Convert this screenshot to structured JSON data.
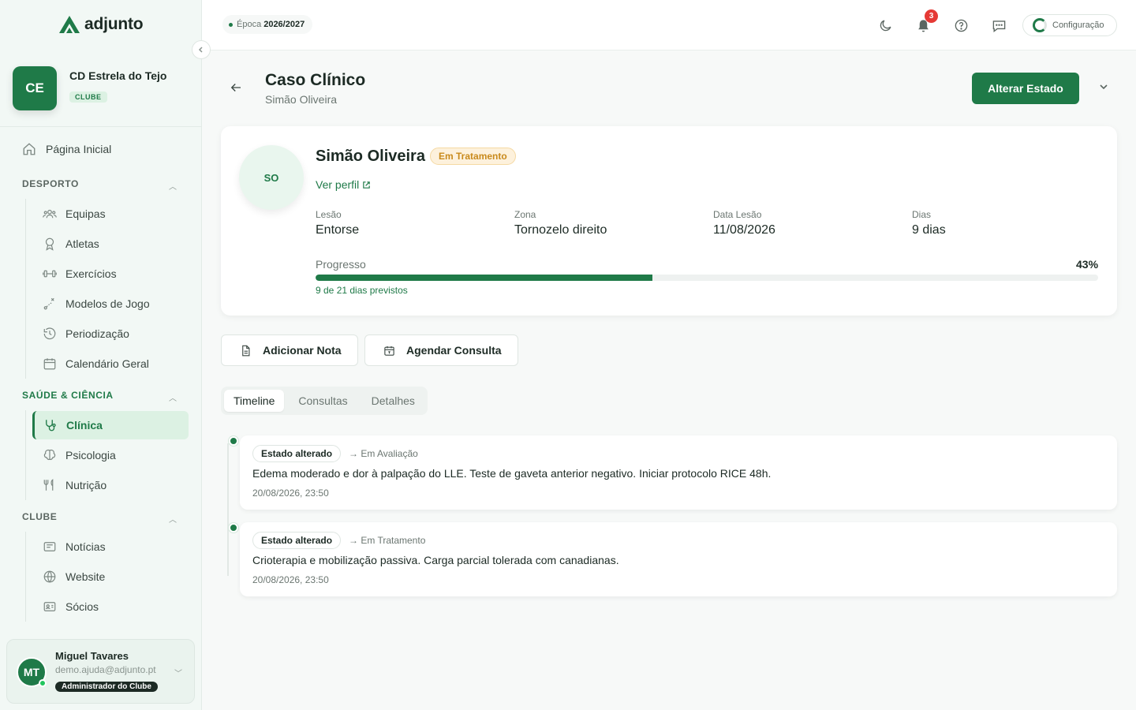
{
  "app": {
    "logo_text": "adjunto"
  },
  "club": {
    "initials": "CE",
    "name": "CD Estrela do Tejo",
    "badge": "CLUBE"
  },
  "sidebar": {
    "home": "Página Inicial",
    "sections": [
      {
        "title": "DESPORTO",
        "items": [
          "Equipas",
          "Atletas",
          "Exercícios",
          "Modelos de Jogo",
          "Periodização",
          "Calendário Geral"
        ]
      },
      {
        "title": "SAÚDE & CIÊNCIA",
        "items": [
          "Clínica",
          "Psicologia",
          "Nutrição"
        ],
        "active_item": "Clínica"
      },
      {
        "title": "CLUBE",
        "items": [
          "Notícias",
          "Website",
          "Sócios"
        ]
      }
    ]
  },
  "user": {
    "initials": "MT",
    "name": "Miguel Tavares",
    "email": "demo.ajuda@adjunto.pt",
    "role": "Administrador do Clube"
  },
  "topbar": {
    "season_prefix": "Época",
    "season_value": "2026/2027",
    "notifications_count": "3",
    "config_label": "Configuração"
  },
  "header": {
    "title": "Caso Clínico",
    "subtitle": "Simão Oliveira",
    "primary_button": "Alterar Estado"
  },
  "patient": {
    "initials": "SO",
    "name": "Simão Oliveira",
    "status": "Em Tratamento",
    "profile_link": "Ver perfil",
    "fields": [
      {
        "label": "Lesão",
        "value": "Entorse"
      },
      {
        "label": "Zona",
        "value": "Tornozelo direito"
      },
      {
        "label": "Data Lesão",
        "value": "11/08/2026"
      },
      {
        "label": "Dias",
        "value": "9 dias"
      }
    ],
    "progress_label": "Progresso",
    "progress_pct_text": "43%",
    "progress_fraction": 0.43,
    "progress_note": "9 de 21 dias previstos"
  },
  "actions": {
    "add_note": "Adicionar Nota",
    "schedule": "Agendar Consulta"
  },
  "tabs": [
    "Timeline",
    "Consultas",
    "Detalhes"
  ],
  "timeline": [
    {
      "badge": "Estado alterado",
      "to": "→ Em Avaliação",
      "text": "Edema moderado e dor à palpação do LLE. Teste de gaveta anterior negativo. Iniciar protocolo RICE 48h.",
      "date": "20/08/2026, 23:50"
    },
    {
      "badge": "Estado alterado",
      "to": "→ Em Tratamento",
      "text": "Crioterapia e mobilização passiva. Carga parcial tolerada com canadianas.",
      "date": "20/08/2026, 23:50"
    }
  ],
  "colors": {
    "brand": "#1f7a48",
    "brand_light": "#dcf1e3",
    "status_warning": "#c98a1c",
    "badge_red": "#e53935"
  }
}
